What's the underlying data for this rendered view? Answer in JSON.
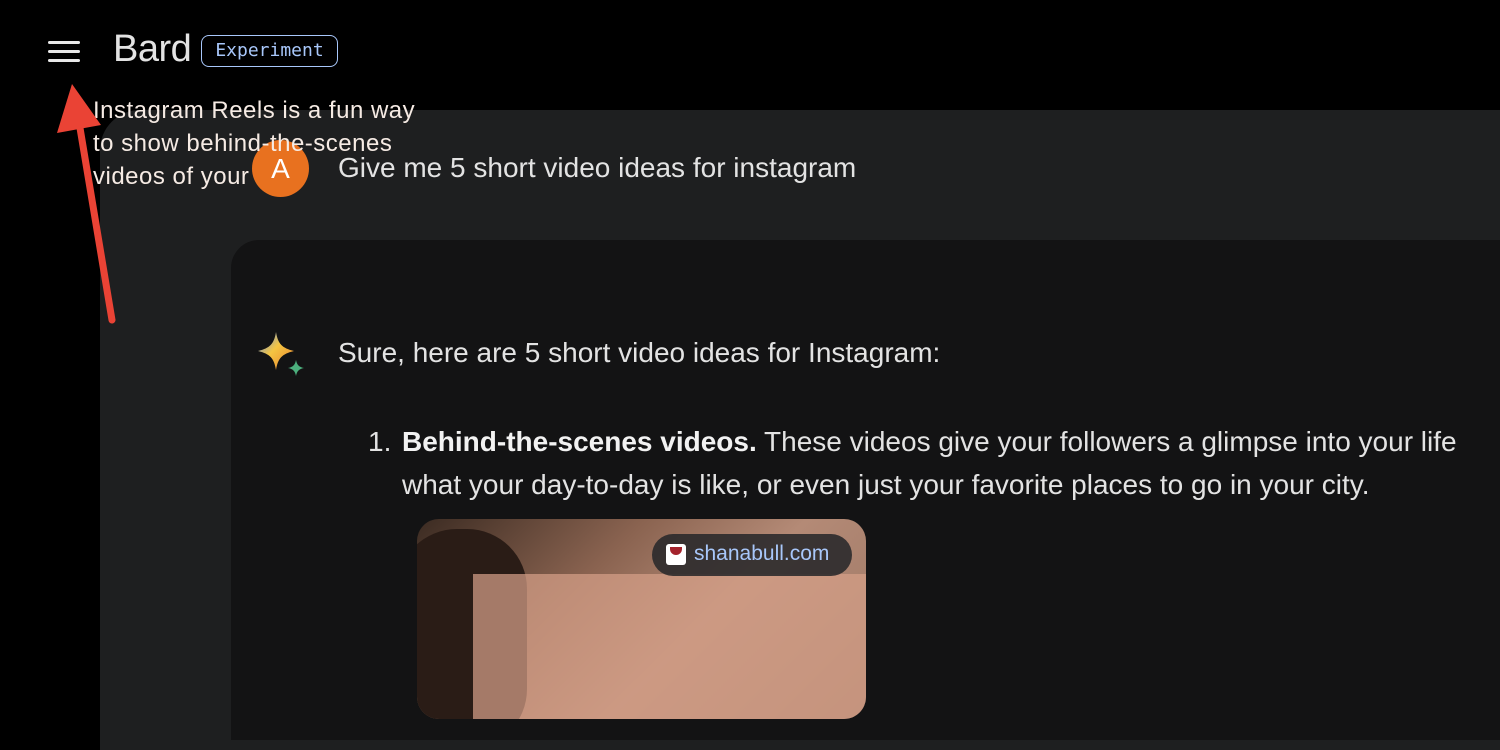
{
  "header": {
    "menu_icon": "menu-icon",
    "title": "Bard",
    "badge": "Experiment"
  },
  "annotation": {
    "type": "red-arrow",
    "color": "#ea4335",
    "points_to": "menu-button"
  },
  "conversation": {
    "user": {
      "avatar_letter": "A",
      "avatar_color": "#e8711f",
      "prompt": "Give me 5 short video ideas for instagram"
    },
    "response": {
      "icon": "bard-sparkle-icon",
      "intro": "Sure, here are 5 short video ideas for Instagram:",
      "items": [
        {
          "number": "1.",
          "title": "Behind-the-scenes videos.",
          "text_line1": " These videos give your followers a glimpse into your life",
          "text_line2": "what your day-to-day is like, or even just your favorite places to go in your city."
        }
      ],
      "image": {
        "source": "shanabull.com",
        "overlay_text": "Instagram Reels is a fun way to show behind-the-scenes videos of your"
      }
    }
  },
  "colors": {
    "background": "#000000",
    "panel": "#1e1f20",
    "response_panel": "#131314",
    "accent": "#a8c7fa"
  }
}
